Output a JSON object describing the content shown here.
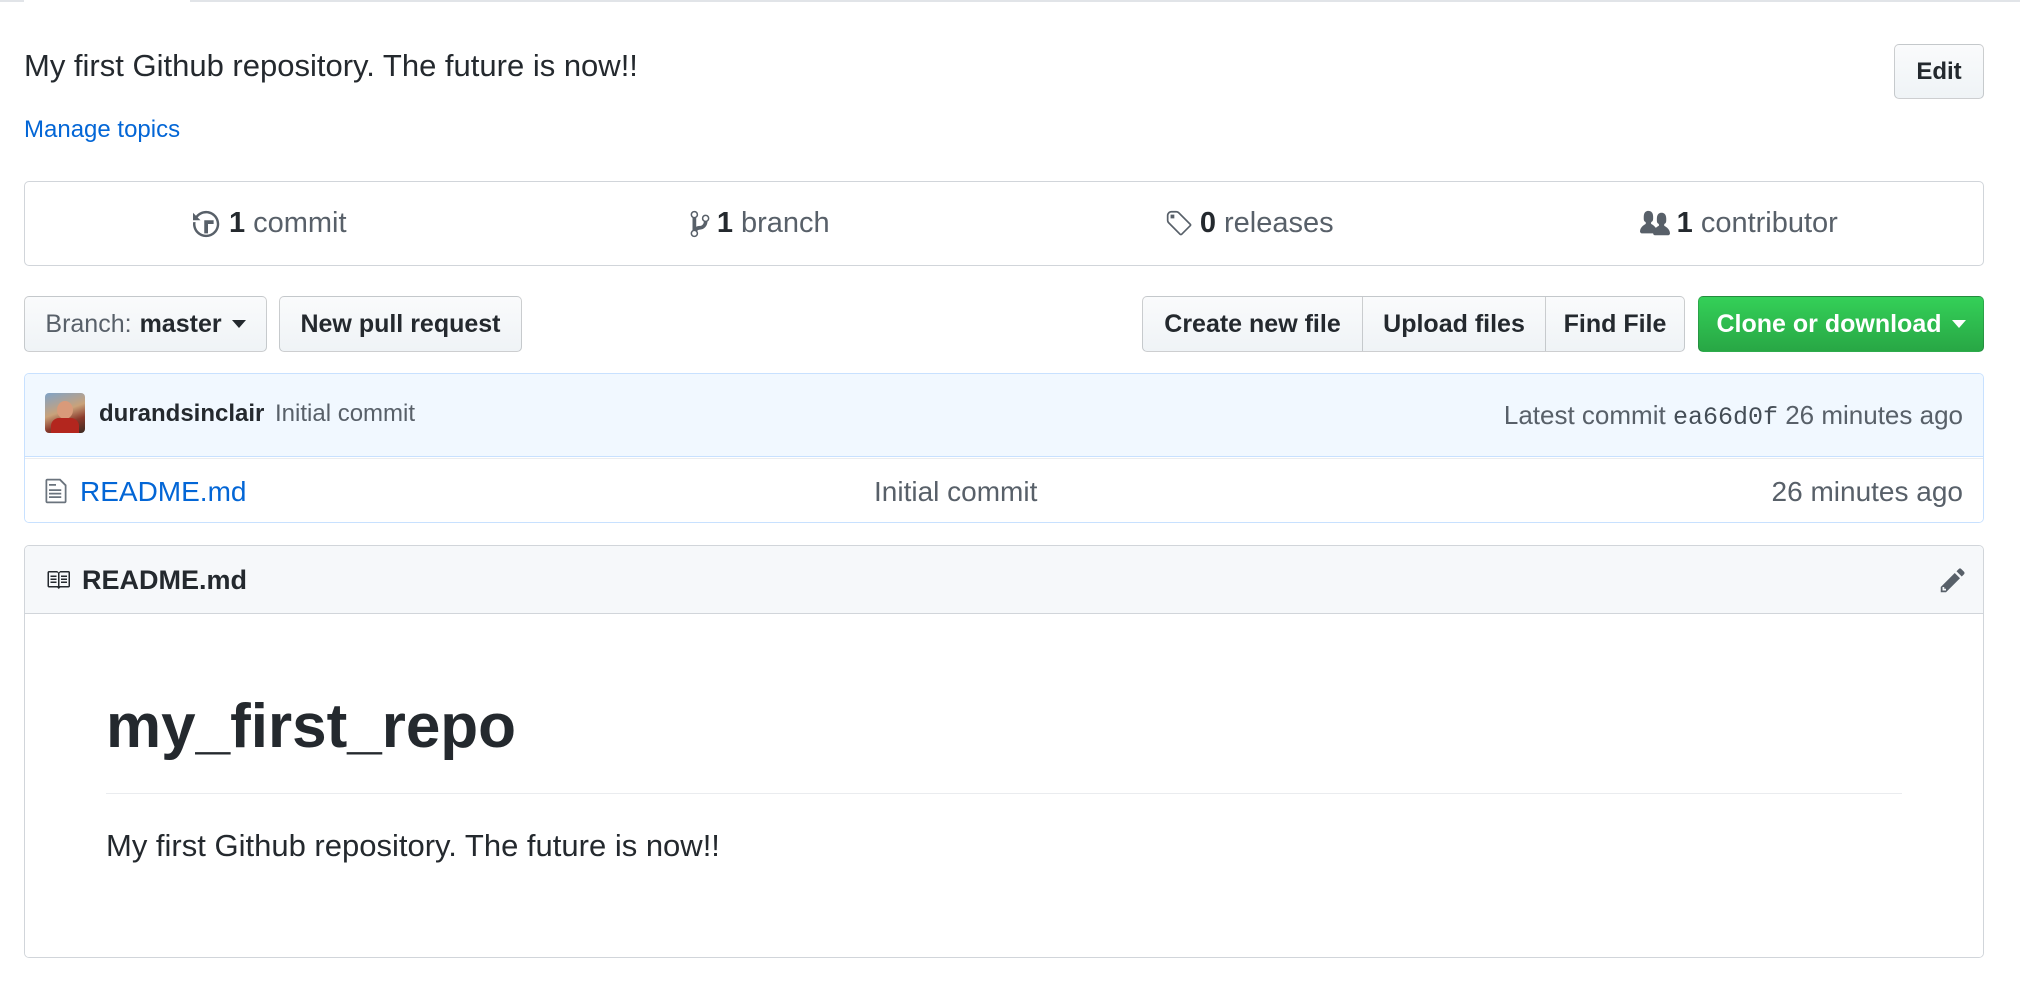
{
  "repo": {
    "description": "My first Github repository. The future is now!!",
    "edit_label": "Edit",
    "manage_topics_label": "Manage topics"
  },
  "stats": [
    {
      "icon": "history-icon",
      "count": "1",
      "label": "commit"
    },
    {
      "icon": "branch-icon",
      "count": "1",
      "label": "branch"
    },
    {
      "icon": "tag-icon",
      "count": "0",
      "label": "releases"
    },
    {
      "icon": "people-icon",
      "count": "1",
      "label": "contributor"
    }
  ],
  "toolbar": {
    "branch_label": "Branch:",
    "branch_value": "master",
    "new_pull_request_label": "New pull request",
    "create_new_file_label": "Create new file",
    "upload_files_label": "Upload files",
    "find_file_label": "Find File",
    "clone_label": "Clone or download"
  },
  "latest_commit": {
    "author": "durandsinclair",
    "message": "Initial commit",
    "prefix": "Latest commit",
    "sha": "ea66d0f",
    "age": "26 minutes ago"
  },
  "files": [
    {
      "icon": "file-icon",
      "name": "README.md",
      "message": "Initial commit",
      "age": "26 minutes ago"
    }
  ],
  "readme": {
    "header_title": "README.md",
    "heading": "my_first_repo",
    "paragraph": "My first Github repository. The future is now!!"
  },
  "colors": {
    "link": "#0366d6",
    "primary_button": "#28a745",
    "commit_tease_bg": "#f1f8ff",
    "text": "#24292e",
    "muted": "#586069"
  }
}
